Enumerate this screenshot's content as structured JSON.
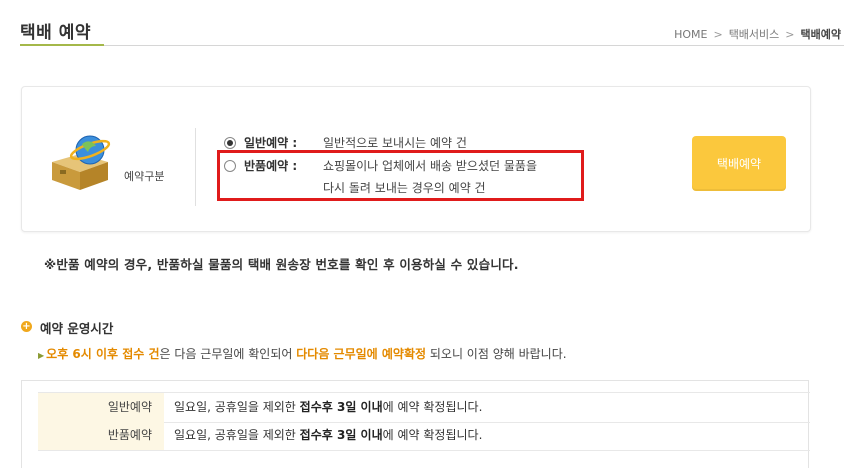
{
  "header": {
    "title": "택배 예약",
    "breadcrumb": [
      "HOME",
      "택배서비스",
      "택배예약"
    ],
    "separator": ">"
  },
  "reservation": {
    "type_label": "예약구분",
    "options": [
      {
        "name": "일반예약 :",
        "desc": "일반적으로 보내시는 예약 건",
        "checked": true
      },
      {
        "name": "반품예약 :",
        "desc_line1": "쇼핑몰이나 업체에서 배송 받으셨던 물품을",
        "desc_line2": "다시 돌려 보내는 경우의 예약 건",
        "checked": false
      }
    ],
    "button_label": "택배예약",
    "button_color": "#fbc83d",
    "highlight_color": "#e01b1b"
  },
  "notice": "※반품 예약의 경우, 반품하실 물품의 택배 원송장 번호를 확인 후 이용하실 수 있습니다.",
  "hours": {
    "title": "예약 운영시간",
    "info": {
      "p1": "오후 6시 이후 접수 건",
      "p2": "은 다음 근무일에 확인되어 ",
      "p3": "다다음 근무일에 예약확정",
      "p4": " 되오니 이점 양해 바랍니다."
    },
    "rows": [
      {
        "label": "일반예약",
        "pre": "일요일, 공휴일을 제외한 ",
        "bold": "접수후 3일 이내",
        "post": "에 예약 확정됩니다."
      },
      {
        "label": "반품예약",
        "pre": "일요일, 공휴일을 제외한 ",
        "bold": "접수후 3일 이내",
        "post": "에 예약 확정됩니다."
      }
    ]
  }
}
